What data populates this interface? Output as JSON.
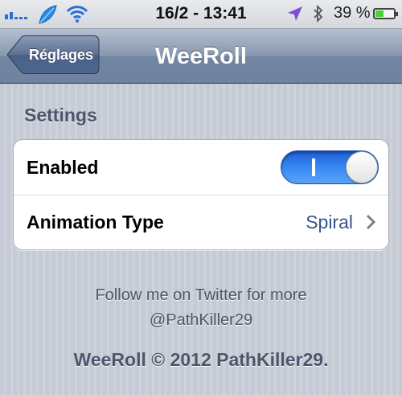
{
  "status_bar": {
    "time": "16/2 - 13:41",
    "battery_percent": "39 %",
    "battery_level": 0.39,
    "icons": [
      "signal-icon",
      "leaf-icon",
      "wifi-icon",
      "location-icon",
      "bluetooth-icon",
      "battery-icon"
    ]
  },
  "nav": {
    "back_label": "Réglages",
    "title": "WeeRoll"
  },
  "settings": {
    "section_header": "Settings",
    "rows": [
      {
        "label": "Enabled",
        "type": "toggle",
        "on": true,
        "on_mark": "I"
      },
      {
        "label": "Animation Type",
        "value": "Spiral",
        "type": "disclosure"
      }
    ]
  },
  "footer": {
    "line1": "Follow me on Twitter for more",
    "line2": "@PathKiller29",
    "line3": "WeeRoll © 2012 PathKiller29."
  },
  "colors": {
    "accent": "#2f7ff0",
    "value_text": "#385487",
    "header_text": "#4c566a"
  }
}
